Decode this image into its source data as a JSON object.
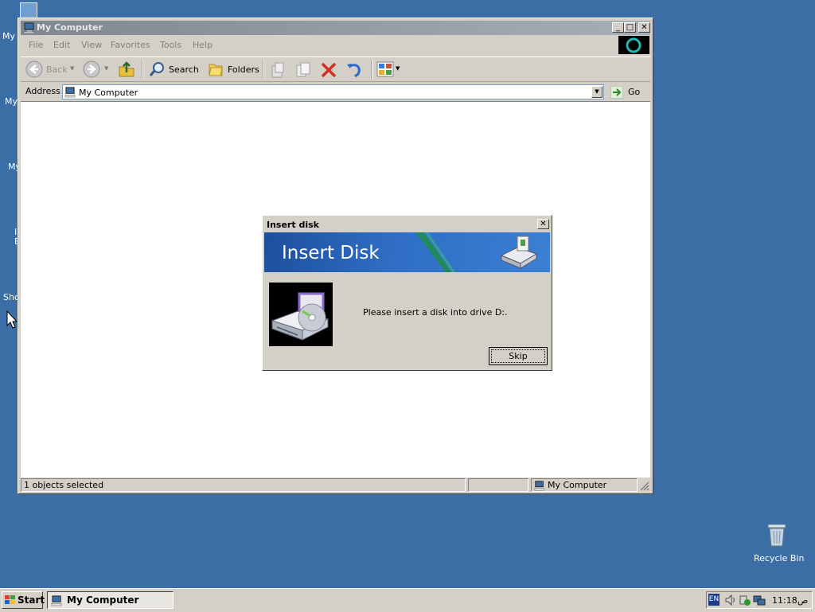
{
  "desktop": {
    "icons": [
      "My",
      "My",
      "My",
      "I\nE",
      "Sho"
    ],
    "recycle_bin": "Recycle Bin"
  },
  "window": {
    "title": "My Computer",
    "caption_min": "_",
    "caption_max": "□",
    "caption_close": "✕",
    "menu": [
      "File",
      "Edit",
      "View",
      "Favorites",
      "Tools",
      "Help"
    ],
    "toolbar": {
      "back": "Back",
      "search": "Search",
      "folders": "Folders"
    },
    "address_label": "Address",
    "address_value": "My Computer",
    "go_label": "Go",
    "status": {
      "selection": "1 objects selected",
      "zone": "My Computer"
    }
  },
  "dialog": {
    "title": "Insert disk",
    "close": "✕",
    "banner_heading": "Insert Disk",
    "message": "Please insert a disk into drive D:.",
    "skip_label": "Skip"
  },
  "taskbar": {
    "start_label": "Start",
    "task_label": "My Computer",
    "lang": "EN",
    "clock": "11:18",
    "ampm": "ص"
  },
  "colors": {
    "desktop": "#3a6ea5",
    "title_inactive": "#7f8891",
    "banner": "#2f6ec4"
  }
}
